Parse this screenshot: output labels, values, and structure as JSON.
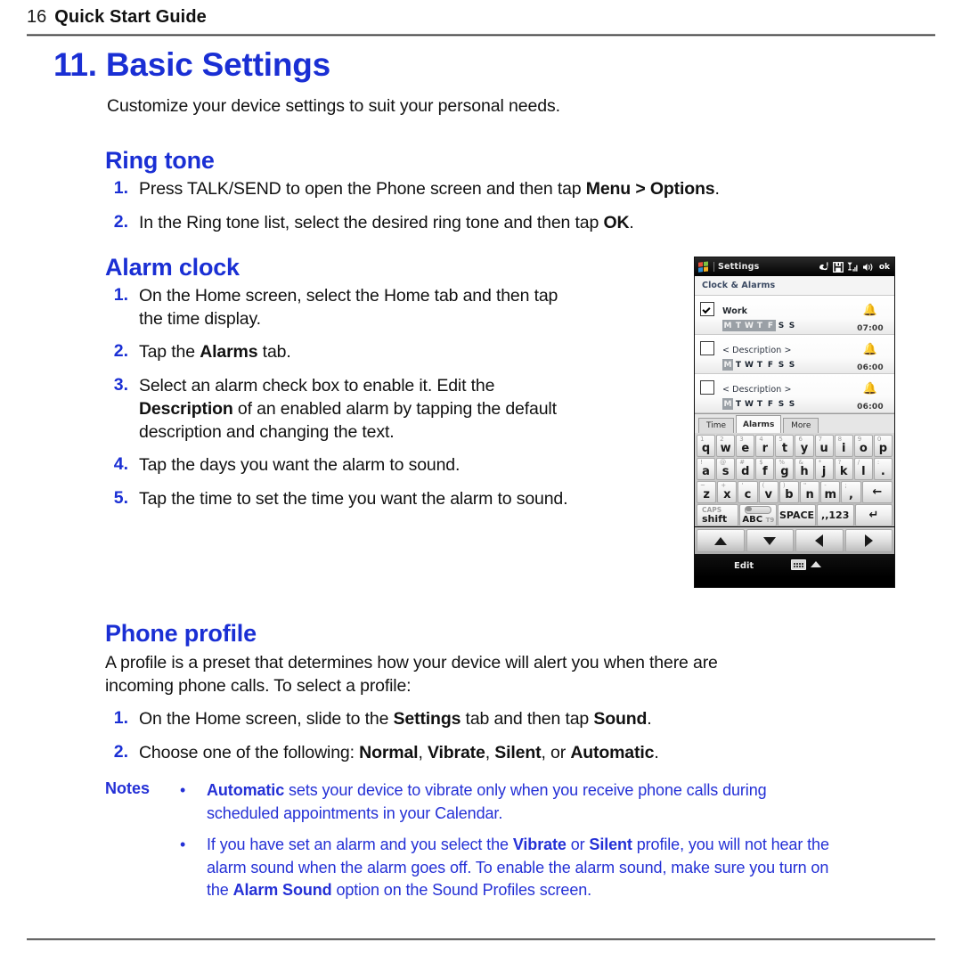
{
  "header": {
    "page_number": "16",
    "title": "Quick Start Guide"
  },
  "chapter": {
    "title": "11. Basic Settings",
    "intro": "Customize your device settings to suit your personal needs."
  },
  "sections": {
    "ring_tone": {
      "heading": "Ring tone",
      "steps": [
        {
          "num": "1.",
          "html": "Press TALK/SEND to open the Phone screen and then tap <b>Menu &gt; Options</b>."
        },
        {
          "num": "2.",
          "html": "In the Ring tone list, select the desired ring tone and then tap <b>OK</b>."
        }
      ]
    },
    "alarm_clock": {
      "heading": "Alarm clock",
      "steps": [
        {
          "num": "1.",
          "html": "On the Home screen, select the Home tab and then tap<br>the time display."
        },
        {
          "num": "2.",
          "html": "Tap the <b>Alarms</b> tab."
        },
        {
          "num": "3.",
          "html": "Select an alarm check box to enable it. Edit the<br><b>Description</b> of an enabled alarm by tapping the default<br>description and changing the text."
        },
        {
          "num": "4.",
          "html": "Tap the days you want the alarm to sound."
        },
        {
          "num": "5.",
          "html": "Tap the time to set the time you want the alarm to sound."
        }
      ]
    },
    "phone_profile": {
      "heading": "Phone profile",
      "paragraph": "A profile is a preset that determines how your device will alert you when there are<br>incoming phone calls. To select a profile:",
      "steps": [
        {
          "num": "1.",
          "html": "On the Home screen, slide to the <b>Settings</b> tab and then tap <b>Sound</b>."
        },
        {
          "num": "2.",
          "html": "Choose one of the following: <b>Normal</b>, <b>Vibrate</b>, <b>Silent</b>, or <b>Automatic</b>."
        }
      ]
    }
  },
  "notes": {
    "label": "Notes",
    "bullet": "•",
    "items": [
      {
        "html": "<b>Automatic</b> sets your device to vibrate only when you receive phone calls during<br>scheduled appointments in your Calendar."
      },
      {
        "html": "If you have set an alarm and you select the <b>Vibrate</b> or <b>Silent</b> profile, you will not hear the<br>alarm sound when the alarm goes off. To enable the alarm sound, make sure you turn on<br>the <b>Alarm Sound</b> option on the Sound Profiles screen."
      }
    ]
  },
  "device": {
    "title_bar": {
      "app_name": "Settings",
      "ok_label": "ok",
      "icons": [
        "windows-flag-icon",
        "phone-missed-icon",
        "save-icon",
        "signal-icon",
        "volume-icon"
      ]
    },
    "subtitle": "Clock & Alarms",
    "alarms": [
      {
        "checked": true,
        "description": "Work",
        "days": [
          "M",
          "T",
          "W",
          "T",
          "F",
          "S",
          "S"
        ],
        "selected_days": [
          true,
          true,
          true,
          true,
          true,
          false,
          false
        ],
        "time": "07:00",
        "bell": "bell-icon"
      },
      {
        "checked": false,
        "description": "< Description >",
        "days": [
          "M",
          "T",
          "W",
          "T",
          "F",
          "S",
          "S"
        ],
        "selected_days": [
          true,
          false,
          false,
          false,
          false,
          false,
          false
        ],
        "time": "06:00",
        "bell": "bell-icon"
      },
      {
        "checked": false,
        "description": "< Description >",
        "days": [
          "M",
          "T",
          "W",
          "T",
          "F",
          "S",
          "S"
        ],
        "selected_days": [
          true,
          false,
          false,
          false,
          false,
          false,
          false
        ],
        "time": "06:00",
        "bell": "bell-icon"
      }
    ],
    "tabs": [
      {
        "label": "Time",
        "active": false
      },
      {
        "label": "Alarms",
        "active": true
      },
      {
        "label": "More",
        "active": false
      }
    ],
    "keyboard": {
      "row1": [
        {
          "sup": "1",
          "main": "q"
        },
        {
          "sup": "2",
          "main": "w"
        },
        {
          "sup": "3",
          "main": "e"
        },
        {
          "sup": "4",
          "main": "r"
        },
        {
          "sup": "5",
          "main": "t"
        },
        {
          "sup": "6",
          "main": "y"
        },
        {
          "sup": "7",
          "main": "u"
        },
        {
          "sup": "8",
          "main": "i"
        },
        {
          "sup": "9",
          "main": "o"
        },
        {
          "sup": "0",
          "main": "p"
        }
      ],
      "row2": [
        {
          "sup": "!",
          "main": "a"
        },
        {
          "sup": "@",
          "main": "s"
        },
        {
          "sup": "#",
          "main": "d"
        },
        {
          "sup": "$",
          "main": "f"
        },
        {
          "sup": "%",
          "main": "g"
        },
        {
          "sup": "&",
          "main": "h"
        },
        {
          "sup": "*",
          "main": "j"
        },
        {
          "sup": "?",
          "main": "k"
        },
        {
          "sup": "/",
          "main": "l"
        },
        {
          "sup": ":",
          "main": "."
        }
      ],
      "row3": [
        {
          "sup": "~",
          "main": "z"
        },
        {
          "sup": "+",
          "main": "x"
        },
        {
          "sup": "'",
          "main": "c"
        },
        {
          "sup": "(",
          "main": "v"
        },
        {
          "sup": ")",
          "main": "b"
        },
        {
          "sup": "\"",
          "main": "n"
        },
        {
          "sup": "-",
          "main": "m"
        },
        {
          "sup": ";",
          "main": ","
        }
      ],
      "backspace": "←",
      "enter": "↵",
      "shift_caps": "CAPS",
      "shift_label": "shift",
      "abc_label": "ABC",
      "t9_label": "T9",
      "space_label": "SPACE",
      "num_label": ",,123",
      "arrows": [
        "up-arrow-icon",
        "down-arrow-icon",
        "left-arrow-icon",
        "right-arrow-icon"
      ]
    },
    "bottom_bar": {
      "edit_label": "Edit",
      "keyboard_icon": "keyboard-icon"
    }
  },
  "colors": {
    "heading_blue": "#1a2fd4",
    "note_blue": "#2430d6",
    "bell_orange": "#d9531e"
  }
}
